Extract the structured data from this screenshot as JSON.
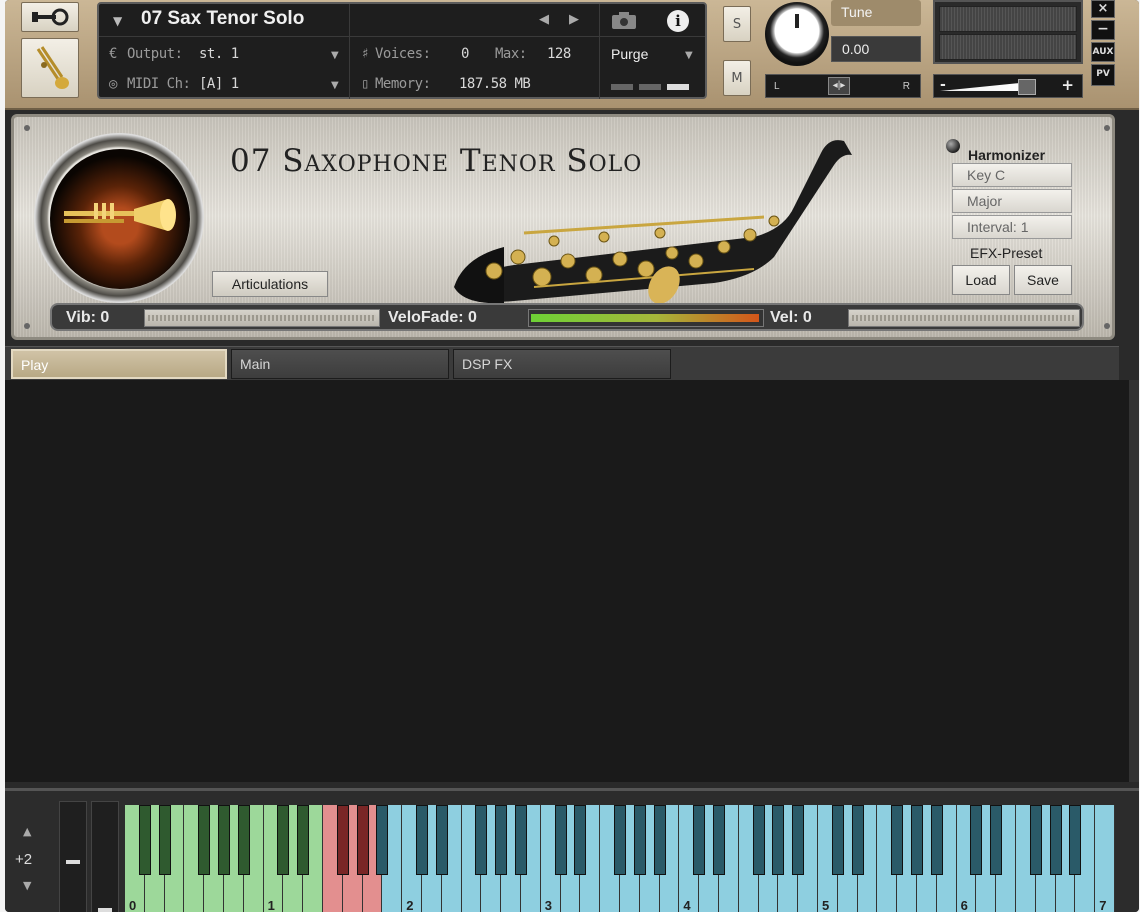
{
  "header": {
    "instrument_name": "07 Sax Tenor Solo",
    "output_label": "Output:",
    "output_value": "st. 1",
    "midi_label": "MIDI Ch:",
    "midi_value": "[A] 1",
    "voices_label": "Voices:",
    "voices_value": "0",
    "max_label": "Max:",
    "max_value": "128",
    "memory_label": "Memory:",
    "memory_value": "187.58 MB",
    "purge_label": "Purge",
    "solo_label": "S",
    "mute_label": "M",
    "tune_label": "Tune",
    "tune_value": "0.00",
    "pan_left": "L",
    "pan_right": "R",
    "vol_minus": "-",
    "vol_plus": "+",
    "close_label": "×",
    "minimize_label": "−",
    "aux_label": "AUX",
    "pv_label": "PV"
  },
  "instrument_panel": {
    "title": "07 Saxophone Tenor Solo",
    "articulations_label": "Articulations",
    "harmonizer_label": "Harmonizer",
    "harmonizer_key": "Key C",
    "harmonizer_scale": "Major",
    "harmonizer_interval": "Interval: 1",
    "efx_preset_label": "EFX-Preset",
    "load_label": "Load",
    "save_label": "Save",
    "vib_label": "Vib: 0",
    "velofade_label": "VeloFade: 0",
    "vel_label": "Vel: 0"
  },
  "tabs": [
    {
      "label": "Play",
      "active": true
    },
    {
      "label": "Main",
      "active": false
    },
    {
      "label": "DSP FX",
      "active": false
    }
  ],
  "keyboard": {
    "octave_shift": "+2",
    "octave_labels": [
      "0",
      "1",
      "2",
      "3",
      "4",
      "5",
      "6",
      "7"
    ],
    "zone_colors": {
      "green": "#9dd89a",
      "red": "#e38f8f",
      "blue": "#8ecfe0"
    }
  },
  "colors": {
    "accent_gold": "#b8a985",
    "panel_dark": "#1e1e1e"
  }
}
